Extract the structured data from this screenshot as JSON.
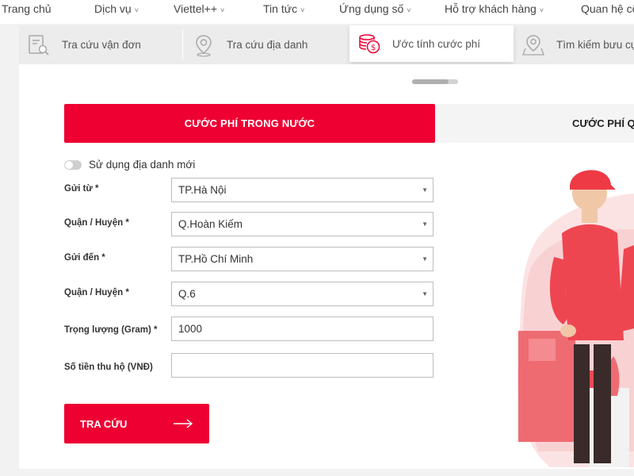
{
  "nav": {
    "items": [
      {
        "label": "Trang chủ",
        "has_dropdown": false
      },
      {
        "label": "Dịch vụ",
        "has_dropdown": true
      },
      {
        "label": "Viettel++",
        "has_dropdown": true
      },
      {
        "label": "Tin tức",
        "has_dropdown": true
      },
      {
        "label": "Ứng dụng số",
        "has_dropdown": true
      },
      {
        "label": "Hỗ trợ khách hàng",
        "has_dropdown": true
      },
      {
        "label": "Quan hệ cổ",
        "has_dropdown": false
      }
    ],
    "chevron": "˅"
  },
  "tabs": [
    {
      "label": "Tra cứu vận đơn",
      "icon": "search-document-icon",
      "active": false
    },
    {
      "label": "Tra cứu địa danh",
      "icon": "location-pin-icon",
      "active": false
    },
    {
      "label": "Ước tính cước phí",
      "icon": "coins-icon",
      "active": true
    },
    {
      "label": "Tìm kiếm bưu cục",
      "icon": "map-pin-icon",
      "active": false
    }
  ],
  "fee_type": {
    "domestic": "CƯỚC PHÍ TRONG NƯỚC",
    "international": "CƯỚC PHÍ QUỐC TẾ"
  },
  "toggle": {
    "label": "Sử dụng địa danh mới",
    "on": false
  },
  "form": {
    "from_label": "Gửi từ *",
    "from_value": "TP.Hà Nội",
    "from_district_label": "Quận / Huyện *",
    "from_district_value": "Q.Hoàn Kiếm",
    "to_label": "Gửi đến *",
    "to_value": "TP.Hồ Chí Minh",
    "to_district_label": "Quận / Huyện *",
    "to_district_value": "Q.6",
    "weight_label": "Trọng lượng (Gram) *",
    "weight_value": "1000",
    "cod_label": "Số tiền thu hộ (VNĐ)",
    "cod_value": "",
    "caret": "▼"
  },
  "search_button": {
    "label": "TRA CỨU",
    "icon": "arrow-right-icon"
  },
  "illustration": {
    "icon": "delivery-person-illustration"
  },
  "colors": {
    "accent": "#ee0033",
    "tab_bg": "#ececec",
    "page_bg": "#f2f2f2"
  }
}
